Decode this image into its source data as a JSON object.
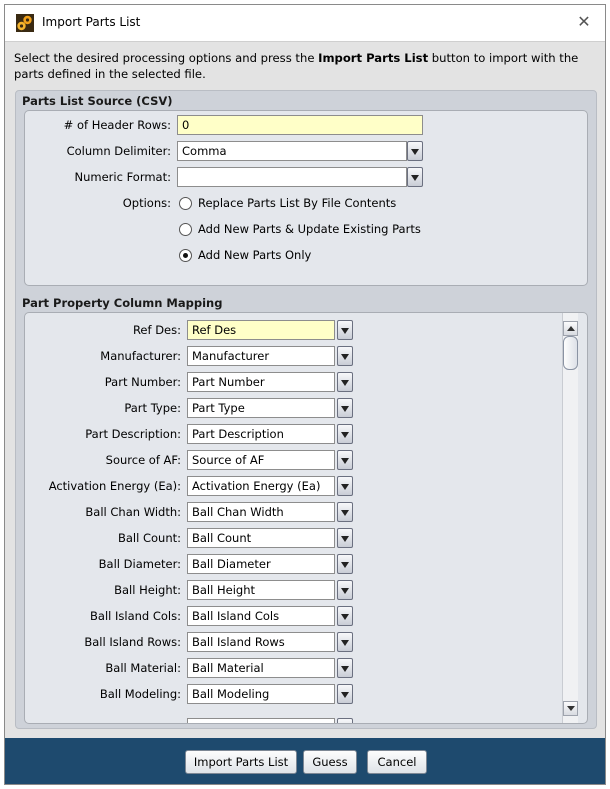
{
  "window": {
    "title": "Import Parts List"
  },
  "instructions": {
    "part1": "Select the desired processing options and press the ",
    "bold": "Import Parts List",
    "part2": " button to import with the parts defined in the selected file."
  },
  "source_group": {
    "title": "Parts List Source (CSV)",
    "header_rows_label": "# of Header Rows:",
    "header_rows_value": "0",
    "delimiter_label": "Column Delimiter:",
    "delimiter_value": "Comma",
    "numeric_label": "Numeric Format:",
    "numeric_value": "",
    "options_label": "Options:",
    "options": [
      {
        "label": "Replace Parts List By File Contents",
        "selected": false
      },
      {
        "label": "Add New Parts & Update Existing Parts",
        "selected": false
      },
      {
        "label": "Add New Parts Only",
        "selected": true
      }
    ]
  },
  "mapping_group": {
    "title": "Part Property Column Mapping",
    "rows": [
      {
        "label": "Ref Des:",
        "value": "Ref Des",
        "highlight": true
      },
      {
        "label": "Manufacturer:",
        "value": "Manufacturer"
      },
      {
        "label": "Part Number:",
        "value": "Part Number"
      },
      {
        "label": "Part Type:",
        "value": "Part Type"
      },
      {
        "label": "Part Description:",
        "value": "Part Description"
      },
      {
        "label": "Source of AF:",
        "value": "Source of AF"
      },
      {
        "label": "Activation Energy (Ea):",
        "value": "Activation Energy (Ea)"
      },
      {
        "label": "Ball Chan Width:",
        "value": "Ball Chan Width"
      },
      {
        "label": "Ball Count:",
        "value": "Ball Count"
      },
      {
        "label": "Ball Diameter:",
        "value": "Ball Diameter"
      },
      {
        "label": "Ball Height:",
        "value": "Ball Height"
      },
      {
        "label": "Ball Island Cols:",
        "value": "Ball Island Cols"
      },
      {
        "label": "Ball Island Rows:",
        "value": "Ball Island Rows"
      },
      {
        "label": "Ball Material:",
        "value": "Ball Material"
      },
      {
        "label": "Ball Modeling:",
        "value": "Ball Modeling"
      }
    ]
  },
  "footer": {
    "import_label": "Import Parts List",
    "guess_label": "Guess",
    "cancel_label": "Cancel"
  },
  "icons": {
    "app": "gear-parts-icon",
    "close": "close-icon"
  }
}
